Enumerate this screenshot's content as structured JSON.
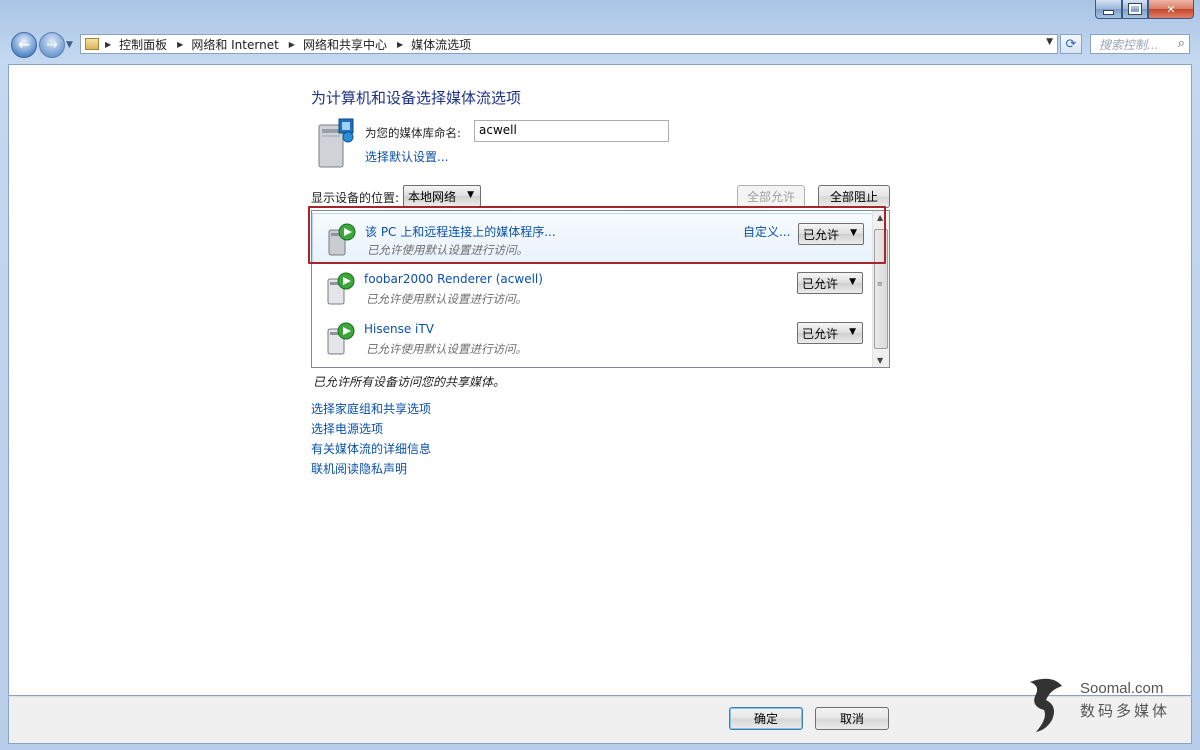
{
  "window": {
    "controls": {
      "minimize": "—",
      "maximize": "□",
      "close": "✕"
    }
  },
  "navigation": {
    "back_icon": "back-arrow-icon",
    "forward_icon": "forward-arrow-icon",
    "breadcrumbs": [
      "控制面板",
      "网络和 Internet",
      "网络和共享中心",
      "媒体流选项"
    ],
    "search_placeholder": "搜索控制..."
  },
  "page": {
    "heading": "为计算机和设备选择媒体流选项",
    "library_name_label": "为您的媒体库命名:",
    "library_name_value": "acwell",
    "default_settings_link": "选择默认设置...",
    "show_devices_label": "显示设备的位置:",
    "network_location": "本地网络",
    "allow_all_button": "全部允许",
    "block_all_button": "全部阻止",
    "devices": [
      {
        "name": "该 PC 上和远程连接上的媒体程序...",
        "description": "已允许使用默认设置进行访问。",
        "customize": "自定义...",
        "status": "已允许"
      },
      {
        "name": "foobar2000 Renderer (acwell)",
        "description": "已允许使用默认设置进行访问。",
        "status": "已允许"
      },
      {
        "name": "Hisense iTV",
        "description": "已允许使用默认设置进行访问。",
        "status": "已允许"
      }
    ],
    "summary": "已允许所有设备访问您的共享媒体。",
    "links": [
      "选择家庭组和共享选项",
      "选择电源选项",
      "有关媒体流的详细信息",
      "联机阅读隐私声明"
    ]
  },
  "footer": {
    "ok_button": "确定",
    "cancel_button": "取消"
  },
  "watermark": {
    "brand": "Soomal.com",
    "brand_cn": "数码多媒体"
  },
  "colors": {
    "link": "#0a50a8",
    "heading": "#1e3287",
    "highlight_box": "#a3262c",
    "chrome": "#b8cde9"
  }
}
